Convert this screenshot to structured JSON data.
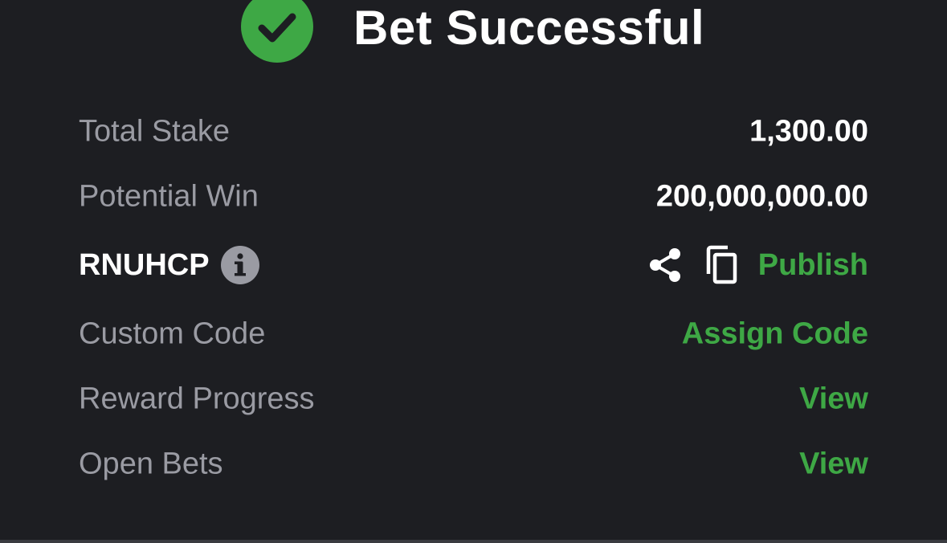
{
  "header": {
    "title": "Bet Successful",
    "status_icon": "check-circle-icon"
  },
  "colors": {
    "accent": "#3ea845",
    "background": "#1d1e22",
    "label": "#9a9ba3",
    "value": "#ffffff"
  },
  "rows": {
    "total_stake": {
      "label": "Total Stake",
      "value": "1,300.00"
    },
    "potential_win": {
      "label": "Potential Win",
      "value": "200,000,000.00"
    },
    "booking": {
      "code": "RNUHCP",
      "info_icon": "info-icon",
      "share_icon": "share-icon",
      "copy_icon": "copy-icon",
      "publish_label": "Publish"
    },
    "custom_code": {
      "label": "Custom Code",
      "action": "Assign Code"
    },
    "reward_progress": {
      "label": "Reward Progress",
      "action": "View"
    },
    "open_bets": {
      "label": "Open Bets",
      "action": "View"
    }
  }
}
